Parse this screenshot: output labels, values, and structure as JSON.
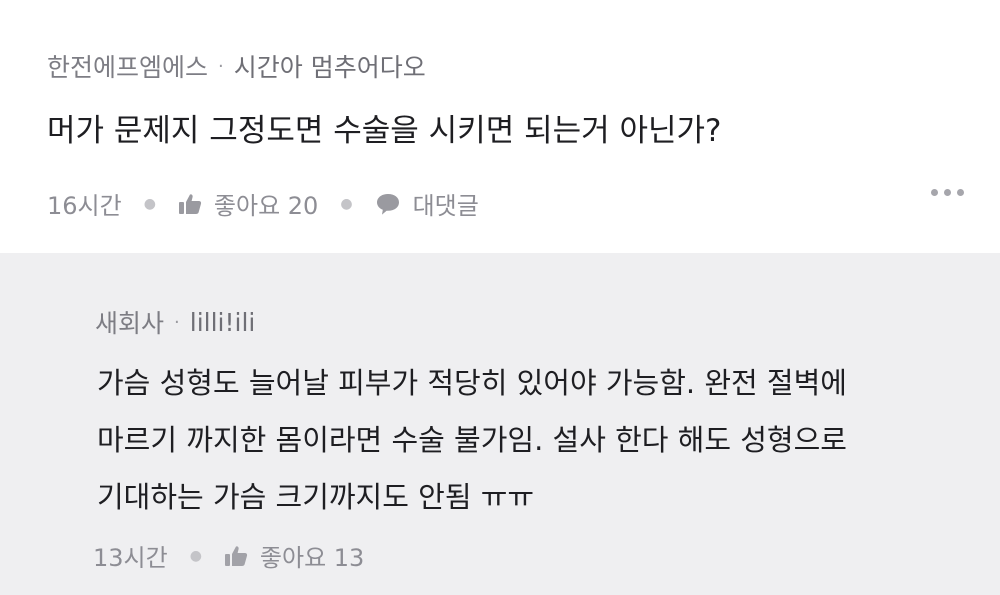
{
  "comment": {
    "author": "한전에프엠에스",
    "separator": "·",
    "user_id": "시간아 멈추어다오",
    "text": "머가 문제지 그정도면 수술을 시키면 되는거 아닌가?",
    "time": "16시간",
    "like_label": "좋아요 20",
    "reply_label": "대댓글",
    "icons": {
      "like": "thumbs-up-icon",
      "reply": "speech-bubble-icon",
      "more": "more-dots-icon"
    }
  },
  "reply": {
    "author": "새회사",
    "separator": "·",
    "user_id": "lilli!ili",
    "lines": [
      "가슴 성형도 늘어날 피부가 적당히 있어야 가능함. 완전 절벽에",
      "마르기 까지한 몸이라면 수술 불가임. 설사 한다 해도 성형으로",
      "기대하는 가슴 크기까지도 안됨 ㅠㅠ"
    ],
    "time": "13시간",
    "like_label": "좋아요 13",
    "icons": {
      "like": "thumbs-up-icon"
    }
  },
  "colors": {
    "reply_background": "#efeff1",
    "meta_text": "#7d7d84",
    "body_text": "#1e1e22"
  }
}
